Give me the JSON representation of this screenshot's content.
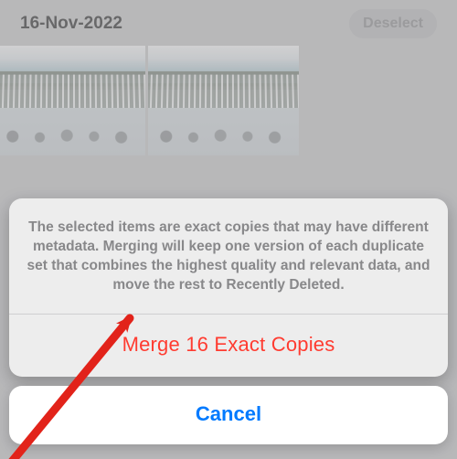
{
  "header": {
    "date_title": "16-Nov-2022",
    "deselect_label": "Deselect"
  },
  "sheet": {
    "message": "The selected items are exact copies that may have different metadata. Merging will keep one version of each duplicate set that combines the highest quality and relevant data, and move the rest to Recently Deleted.",
    "merge_label": "Merge 16 Exact Copies",
    "cancel_label": "Cancel"
  },
  "annotation": {
    "arrow_color": "#e2231a"
  }
}
